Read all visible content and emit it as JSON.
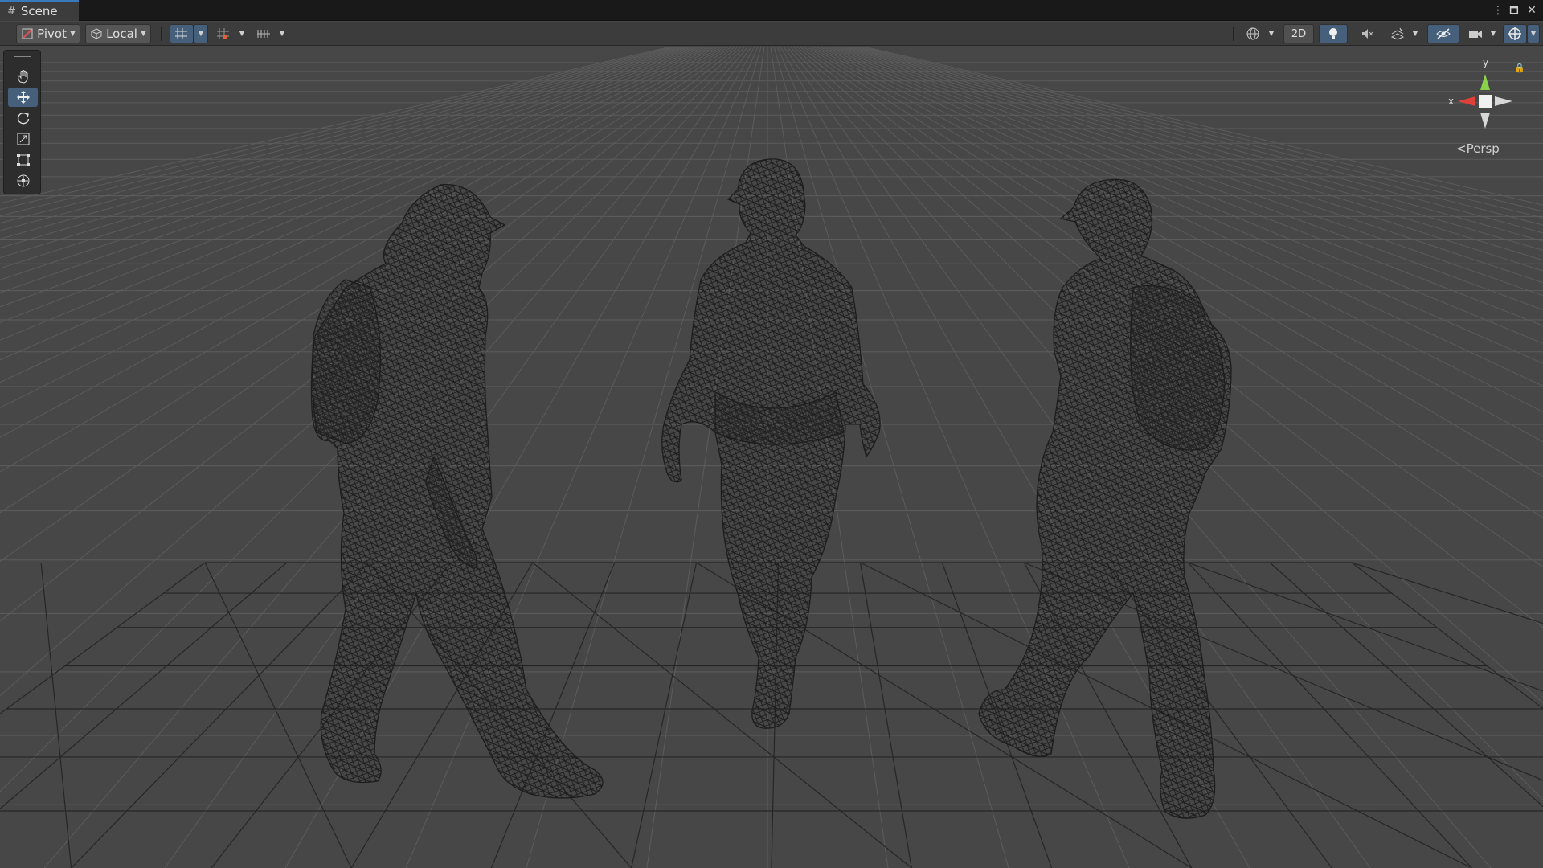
{
  "tab": {
    "title": "Scene",
    "icon": "grid-icon"
  },
  "window_controls": {
    "more": "⋮",
    "maximize": "🗖",
    "close": "✕"
  },
  "toolbar": {
    "pivot_label": "Pivot",
    "space_label": "Local",
    "view_2d_label": "2D"
  },
  "gizmo": {
    "y_label": "y",
    "x_label": "x",
    "projection_label": "Persp"
  },
  "colors": {
    "active_blue": "#46607c",
    "tab_accent": "#3a79bb",
    "viewport_bg": "#474747",
    "axis_x": "#e0403a",
    "axis_y": "#8ad24a"
  }
}
